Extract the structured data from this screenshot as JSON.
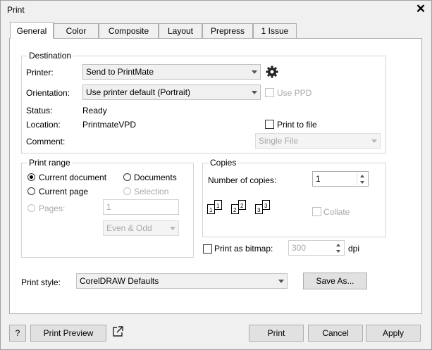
{
  "window": {
    "title": "Print"
  },
  "tabs": [
    {
      "label": "General"
    },
    {
      "label": "Color"
    },
    {
      "label": "Composite"
    },
    {
      "label": "Layout"
    },
    {
      "label": "Prepress"
    },
    {
      "label": "1 Issue"
    }
  ],
  "destination": {
    "legend": "Destination",
    "printer_label": "Printer:",
    "printer_value": "Send to PrintMate",
    "orientation_label": "Orientation:",
    "orientation_value": "Use printer default (Portrait)",
    "use_ppd_label": "Use PPD",
    "status_label": "Status:",
    "status_value": "Ready",
    "location_label": "Location:",
    "location_value": "PrintmateVPD",
    "comment_label": "Comment:",
    "print_to_file_label": "Print to file",
    "file_mode_value": "Single File"
  },
  "print_range": {
    "legend": "Print range",
    "current_document": "Current document",
    "documents": "Documents",
    "current_page": "Current page",
    "selection": "Selection",
    "pages_label": "Pages:",
    "pages_value": "1",
    "even_odd_value": "Even & Odd"
  },
  "copies": {
    "legend": "Copies",
    "number_label": "Number of copies:",
    "number_value": "1",
    "collate_label": "Collate",
    "page_numbers": [
      "1",
      "1",
      "2",
      "2",
      "3",
      "3"
    ]
  },
  "bitmap": {
    "label": "Print as bitmap:",
    "value": "300",
    "unit": "dpi"
  },
  "print_style": {
    "label": "Print style:",
    "value": "CorelDRAW Defaults",
    "save_as": "Save As..."
  },
  "footer": {
    "help": "?",
    "preview": "Print Preview",
    "print": "Print",
    "cancel": "Cancel",
    "apply": "Apply"
  }
}
